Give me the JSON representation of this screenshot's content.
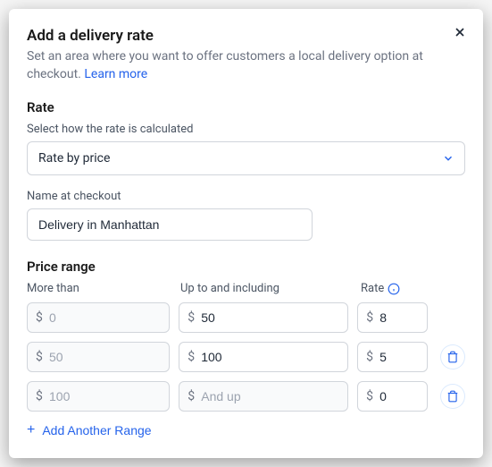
{
  "header": {
    "title": "Add a delivery rate",
    "subtitle": "Set an area where you want to offer customers a local delivery option at checkout.",
    "learn_more": "Learn more"
  },
  "rate_section": {
    "heading": "Rate",
    "calc_label": "Select how the rate is calculated",
    "calc_value": "Rate by price",
    "name_label": "Name at checkout",
    "name_value": "Delivery in Manhattan"
  },
  "price_section": {
    "heading": "Price range",
    "col_more": "More than",
    "col_upto": "Up to and including",
    "col_rate": "Rate",
    "currency": "$",
    "and_up_placeholder": "And up",
    "rows": [
      {
        "more": "0",
        "upto": "50",
        "rate": "8",
        "deletable": false
      },
      {
        "more": "50",
        "upto": "100",
        "rate": "5",
        "deletable": true
      },
      {
        "more": "100",
        "upto": "",
        "rate": "0",
        "deletable": true,
        "is_last": true
      }
    ],
    "add_label": "Add Another Range"
  }
}
